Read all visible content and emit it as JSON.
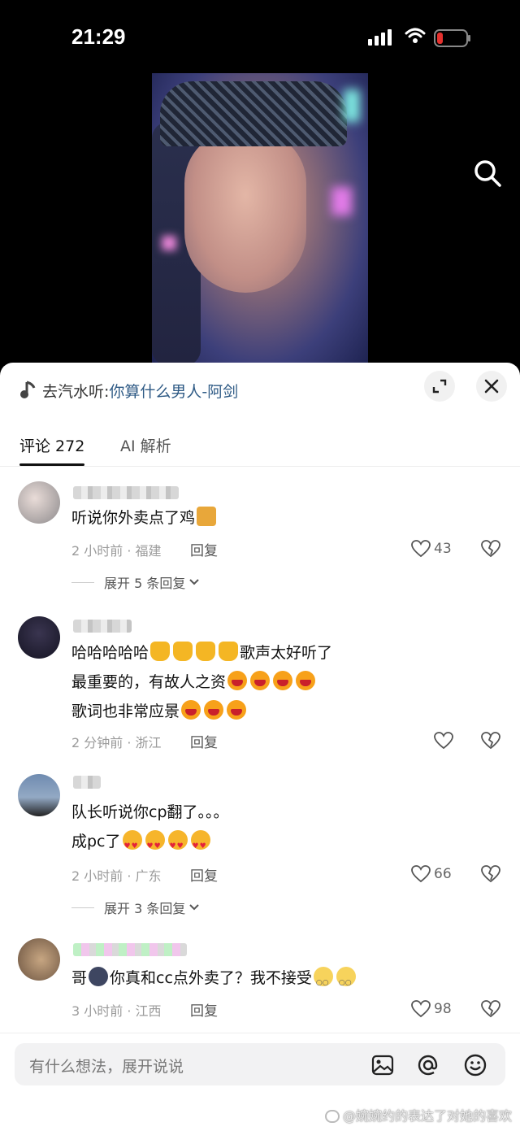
{
  "status_bar": {
    "time": "21:29"
  },
  "music": {
    "prefix": "去汽水听:",
    "song": "你算什么男人-阿剑"
  },
  "tabs": {
    "comments": "评论 272",
    "ai": "AI 解析"
  },
  "comments": [
    {
      "lines": [
        "听说你外卖点了鸡"
      ],
      "meta": "2 小时前 · 福建",
      "reply": "回复",
      "likes": "43",
      "expand": "展开 5 条回复"
    },
    {
      "lines": [
        "哈哈哈哈哈",
        "歌声太好听了",
        "最重要的，有故人之资",
        "歌词也非常应景"
      ],
      "meta": "2 分钟前 · 浙江",
      "reply": "回复",
      "likes": ""
    },
    {
      "lines": [
        "队长听说你cp翻了。。。",
        "成pc了"
      ],
      "meta": "2 小时前 · 广东",
      "reply": "回复",
      "likes": "66",
      "expand": "展开 3 条回复"
    },
    {
      "lines": [
        "哥",
        "你真和cc点外卖了？我不接受"
      ],
      "meta": "3 小时前 · 江西",
      "reply": "回复",
      "likes": "98"
    }
  ],
  "input": {
    "placeholder": "有什么想法，展开说说"
  },
  "watermark": "@婉婉约的表达了对她的喜欢"
}
